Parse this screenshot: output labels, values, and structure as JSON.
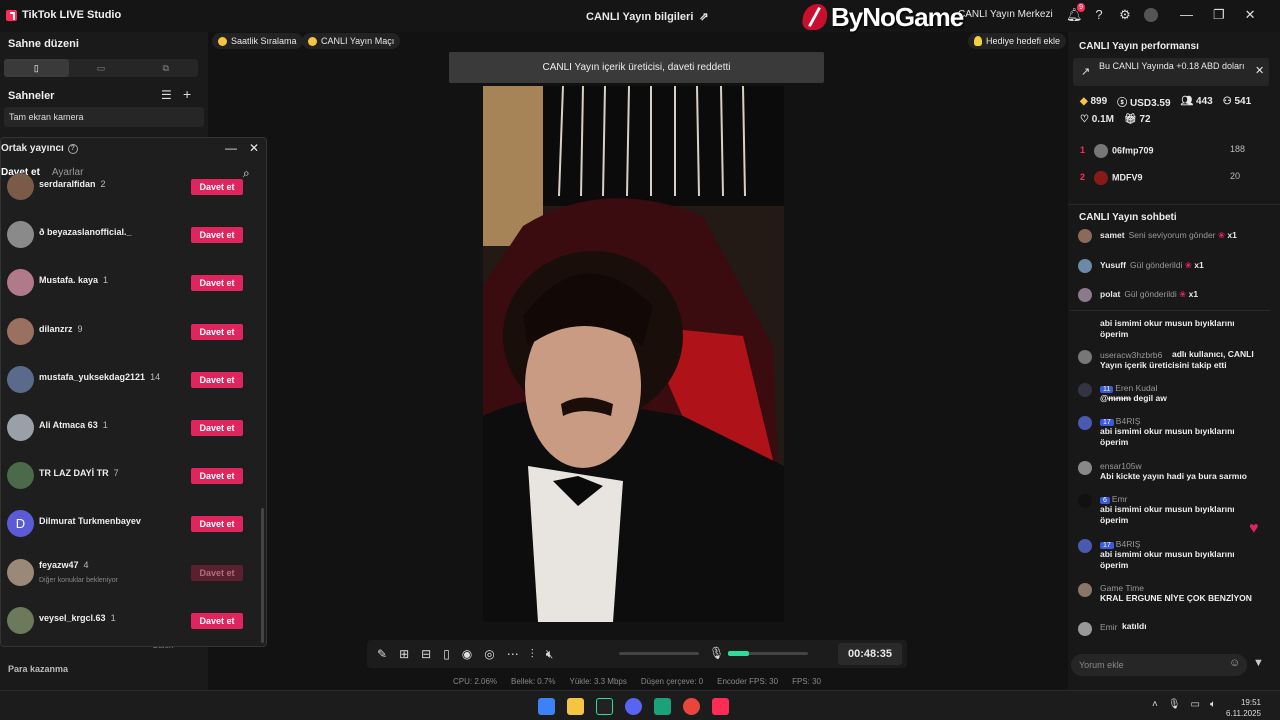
{
  "titlebar": {
    "app_name": "TikTok LIVE Studio",
    "center_title": "CANLI Yayın bilgileri",
    "watermark": "ByNoGame",
    "live_center": "CANLI Yayın Merkezi",
    "notif_count": "9"
  },
  "left": {
    "layout_title": "Sahne düzeni",
    "scenes_title": "Sahneler",
    "scene_item": "Tam ekran kamera",
    "footer": "Para kazanma",
    "footer2": "Galeri"
  },
  "cohost": {
    "title": "Ortak yayıncı",
    "tab_invite": "Davet et",
    "tab_settings": "Ayarlar",
    "users": [
      {
        "name": "serdaralfidan",
        "count": "2",
        "button": "Davet et",
        "sub": ""
      },
      {
        "name": "ð beyazaslanofficial._",
        "count": "",
        "button": "Davet et",
        "sub": ""
      },
      {
        "name": "Mustafa. kaya",
        "count": "1",
        "button": "Davet et",
        "sub": ""
      },
      {
        "name": "dilanzrz",
        "count": "9",
        "button": "Davet et",
        "sub": ""
      },
      {
        "name": "mustafa_yuksekdag2121",
        "count": "14",
        "button": "Davet et",
        "sub": ""
      },
      {
        "name": "Ali Atmaca 63",
        "count": "1",
        "button": "Davet et",
        "sub": ""
      },
      {
        "name": "TR LAZ DAYİ TR",
        "count": "7",
        "button": "Davet et",
        "sub": ""
      },
      {
        "name": "Dilmurat Turkmenbayev",
        "count": "",
        "button": "Davet et",
        "sub": ""
      },
      {
        "name": "feyazw47",
        "count": "4",
        "button": "Davet et",
        "sub": "Diğer konuklar bekleniyor"
      },
      {
        "name": "veysel_krgcl.63",
        "count": "1",
        "button": "Davet et",
        "sub": ""
      }
    ]
  },
  "chips": {
    "hourly": "Saatlik Sıralama",
    "match": "CANLI Yayın Maçı",
    "gift_goal": "Hediye hedefi ekle"
  },
  "notification": "CANLI Yayın içerik üreticisi, daveti reddetti",
  "controls": {
    "timer": "00:48:35",
    "mic_level": 0.26,
    "volume_level": 0
  },
  "stats": {
    "cpu": "CPU: 2.06%",
    "memory": "Bellek: 0.7%",
    "upload": "Yükle: 3.3 Mbps",
    "dropped": "Düşen çerçeve: 0",
    "encoder_fps": "Encoder FPS: 30",
    "fps": "FPS: 30"
  },
  "perf": {
    "title": "CANLI Yayın performansı",
    "banner": "Bu CANLI Yayında +0.18 ABD doları",
    "diamonds": "899",
    "usd": "USD3.59",
    "viewers": "443",
    "followers": "541",
    "likes": "0.1M",
    "gifts": "72",
    "ranking": [
      {
        "n": "1",
        "name": "06fmp709",
        "score": "188"
      },
      {
        "n": "2",
        "name": "MDFV9",
        "score": "20"
      }
    ]
  },
  "chat": {
    "title": "CANLI Yayın sohbeti",
    "gifts": [
      {
        "name": "samet",
        "text": "Seni seviyorum gönder",
        "mult": "x1"
      },
      {
        "name": "Yusuff",
        "text": "Gül gönderildi",
        "mult": "x1"
      },
      {
        "name": "polat",
        "text": "Gül gönderildi",
        "mult": "x1"
      }
    ],
    "messages": [
      {
        "name": "",
        "level": "",
        "text": "abi ismimi okur musun bıyıklarını öperim"
      },
      {
        "name": "useracw3hzbrb6",
        "level": "",
        "text": "adlı kullanıcı, CANLI Yayın içerik üreticisini takip etti"
      },
      {
        "name": "Eren Kudal",
        "level": "11",
        "text": "@ᵯᵯᵯ degil aw"
      },
      {
        "name": "B4RIŞ",
        "level": "17",
        "text": "abi ismimi okur musun bıyıklarını öperim"
      },
      {
        "name": "ensar105w",
        "level": "",
        "text": "Abi kickte yayın hadi ya bura sarmıo"
      },
      {
        "name": "Emr",
        "level": "6",
        "text": "abi ismimi okur musun bıyıklarını öperim"
      },
      {
        "name": "B4RIŞ",
        "level": "17",
        "text": "abi ismimi okur musun bıyıklarını öperim"
      },
      {
        "name": "Game Time",
        "level": "",
        "text": "KRAL ERGUNE NİYE ÇOK BENZİYON"
      },
      {
        "name": "Emir",
        "level": "",
        "text": "katıldı"
      }
    ],
    "input_placeholder": "Yorum ekle"
  },
  "taskbar": {
    "time": "19:51",
    "date": "6.11.2025"
  }
}
